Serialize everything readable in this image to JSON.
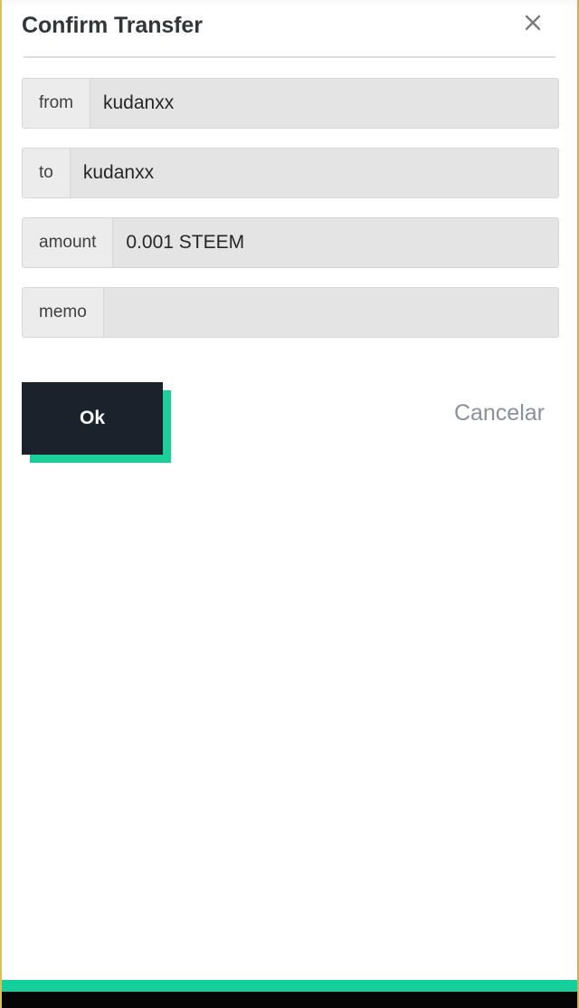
{
  "dialog": {
    "title": "Confirm Transfer",
    "close_icon": "close-icon",
    "fields": [
      {
        "label": "from",
        "value": "kudanxx"
      },
      {
        "label": "to",
        "value": "kudanxx"
      },
      {
        "label": "amount",
        "value": "0.001 STEEM"
      },
      {
        "label": "memo",
        "value": ""
      }
    ],
    "actions": {
      "confirm_label": "Ok",
      "cancel_label": "Cancelar"
    }
  },
  "colors": {
    "accent_teal": "#14cf9a",
    "button_dark": "#1b222b",
    "page_border_yellow": "#d9c159",
    "field_fill": "#e4e4e4",
    "field_label_fill": "#ececec",
    "cancel_text": "#8a919a"
  }
}
